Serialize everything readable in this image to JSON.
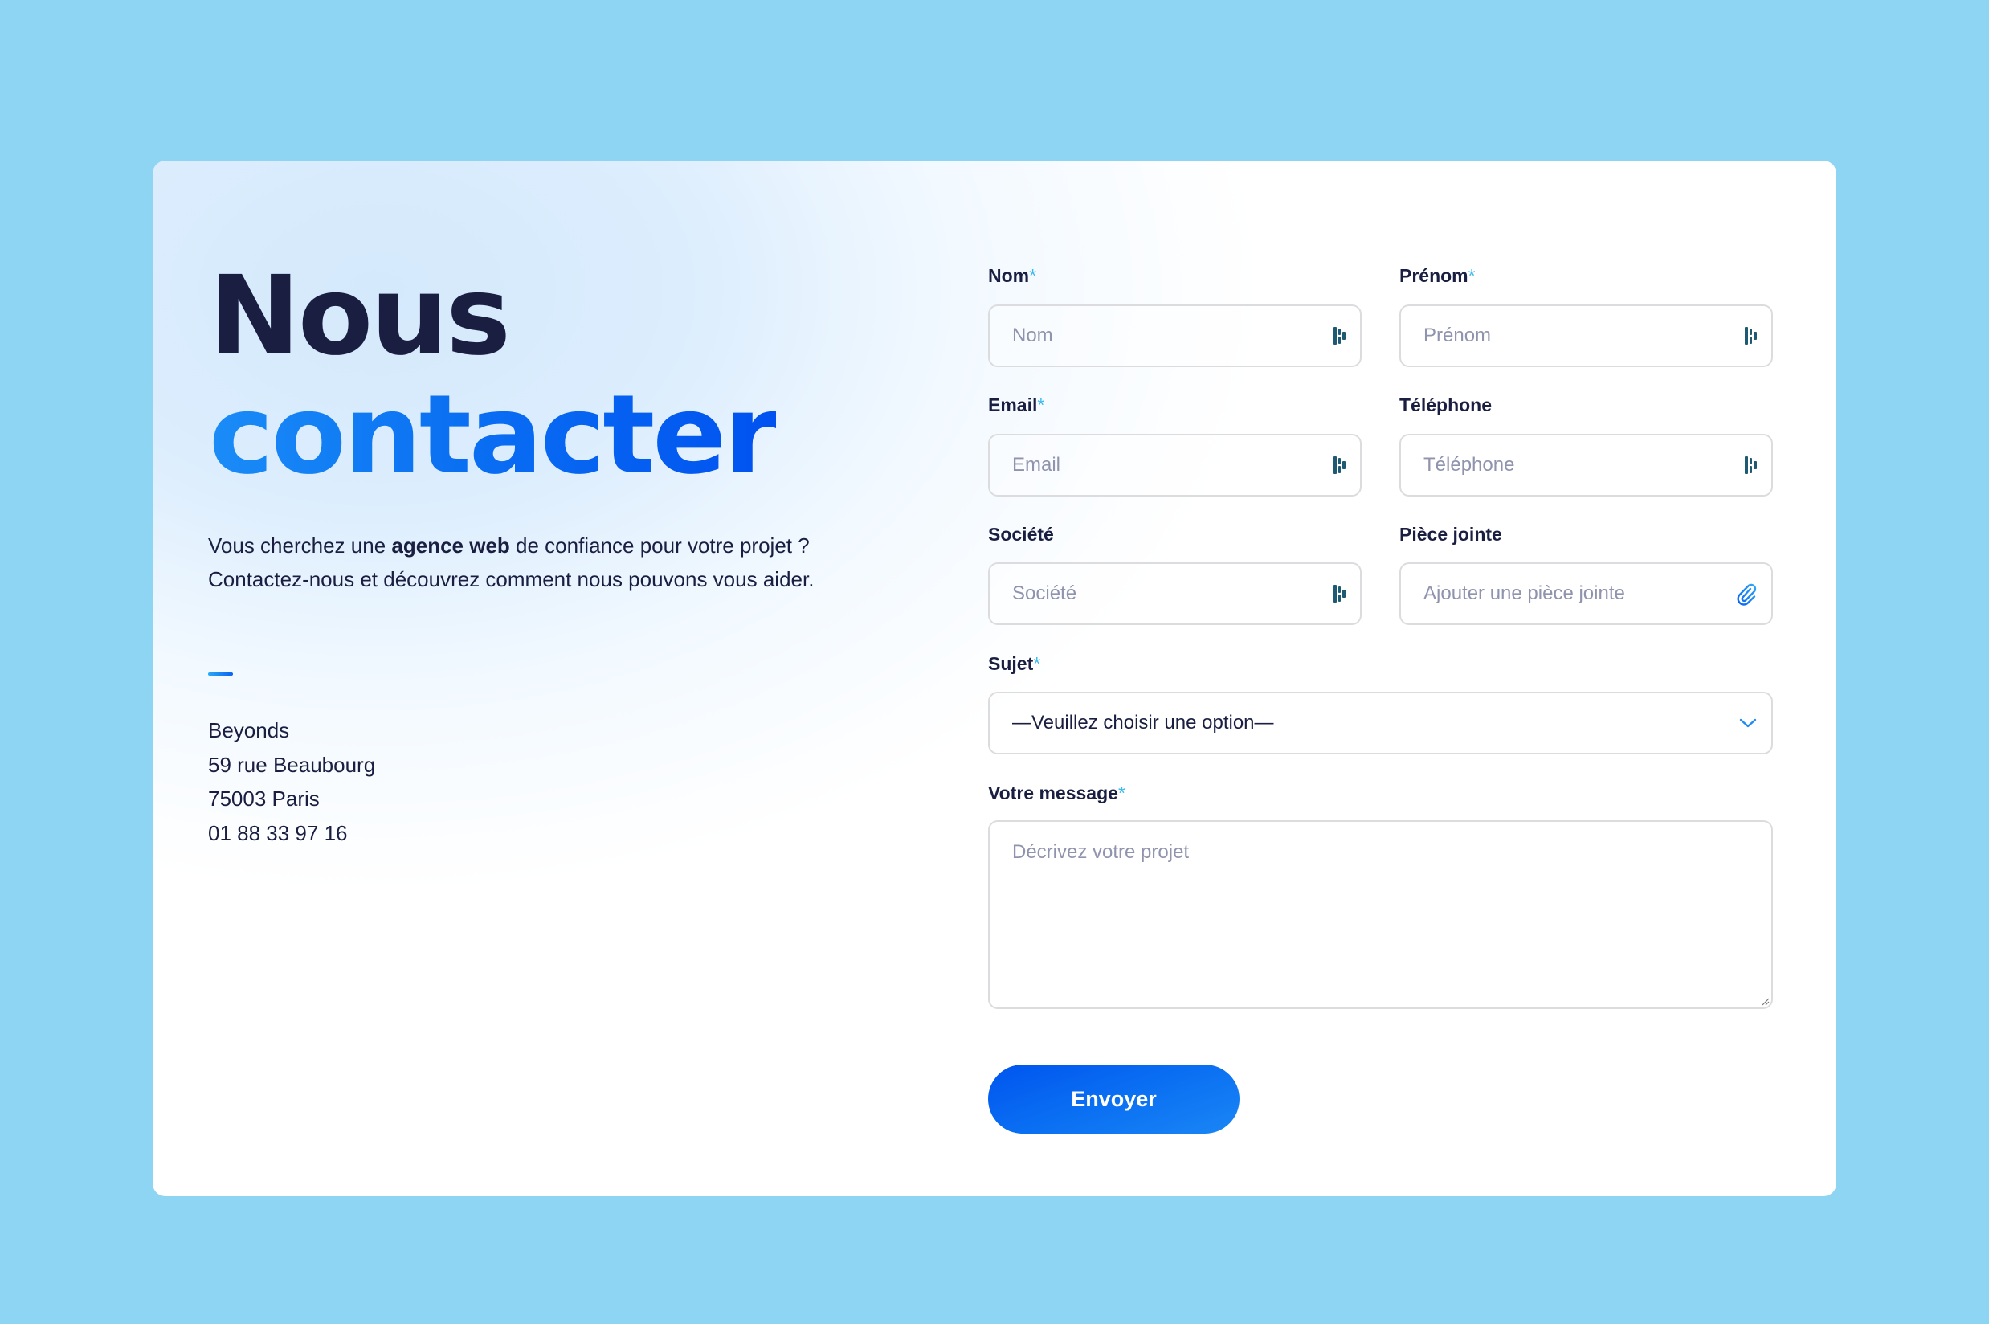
{
  "colors": {
    "page_background": "#8ed4f3",
    "heading_dark": "#1a1f42",
    "accent_blue": "#0a6ff2",
    "required_star": "#3cb9ee",
    "placeholder": "#8f93ad",
    "input_border": "#dcdcdf"
  },
  "left": {
    "title_line1": "Nous",
    "title_line2": "contacter",
    "intro_before": "Vous cherchez une ",
    "intro_bold": "agence web",
    "intro_after": " de confiance pour votre projet ? Contactez-nous et découvrez comment nous pouvons vous aider.",
    "address": {
      "company": "Beyonds",
      "street": "59 rue Beaubourg",
      "city": "75003 Paris",
      "phone": "01 88 33 97 16"
    }
  },
  "form": {
    "required_marker": "*",
    "fields": {
      "nom": {
        "label": "Nom",
        "required": true,
        "placeholder": "Nom",
        "value": ""
      },
      "prenom": {
        "label": "Prénom",
        "required": true,
        "placeholder": "Prénom",
        "value": ""
      },
      "email": {
        "label": "Email",
        "required": true,
        "placeholder": "Email",
        "value": ""
      },
      "telephone": {
        "label": "Téléphone",
        "required": false,
        "placeholder": "Téléphone",
        "value": ""
      },
      "societe": {
        "label": "Société",
        "required": false,
        "placeholder": "Société",
        "value": ""
      },
      "piece_jointe": {
        "label": "Pièce jointe",
        "required": false,
        "placeholder": "Ajouter une pièce jointe",
        "value": ""
      },
      "sujet": {
        "label": "Sujet",
        "required": true,
        "selected": "—Veuillez choisir une option—"
      },
      "message": {
        "label": "Votre message",
        "required": true,
        "placeholder": "Décrivez votre projet",
        "value": ""
      }
    },
    "submit_label": "Envoyer",
    "icons": {
      "autofill": "password-manager-icon",
      "attachment": "paperclip-icon",
      "select": "chevron-down-icon",
      "resize": "resize-grip-icon"
    }
  }
}
